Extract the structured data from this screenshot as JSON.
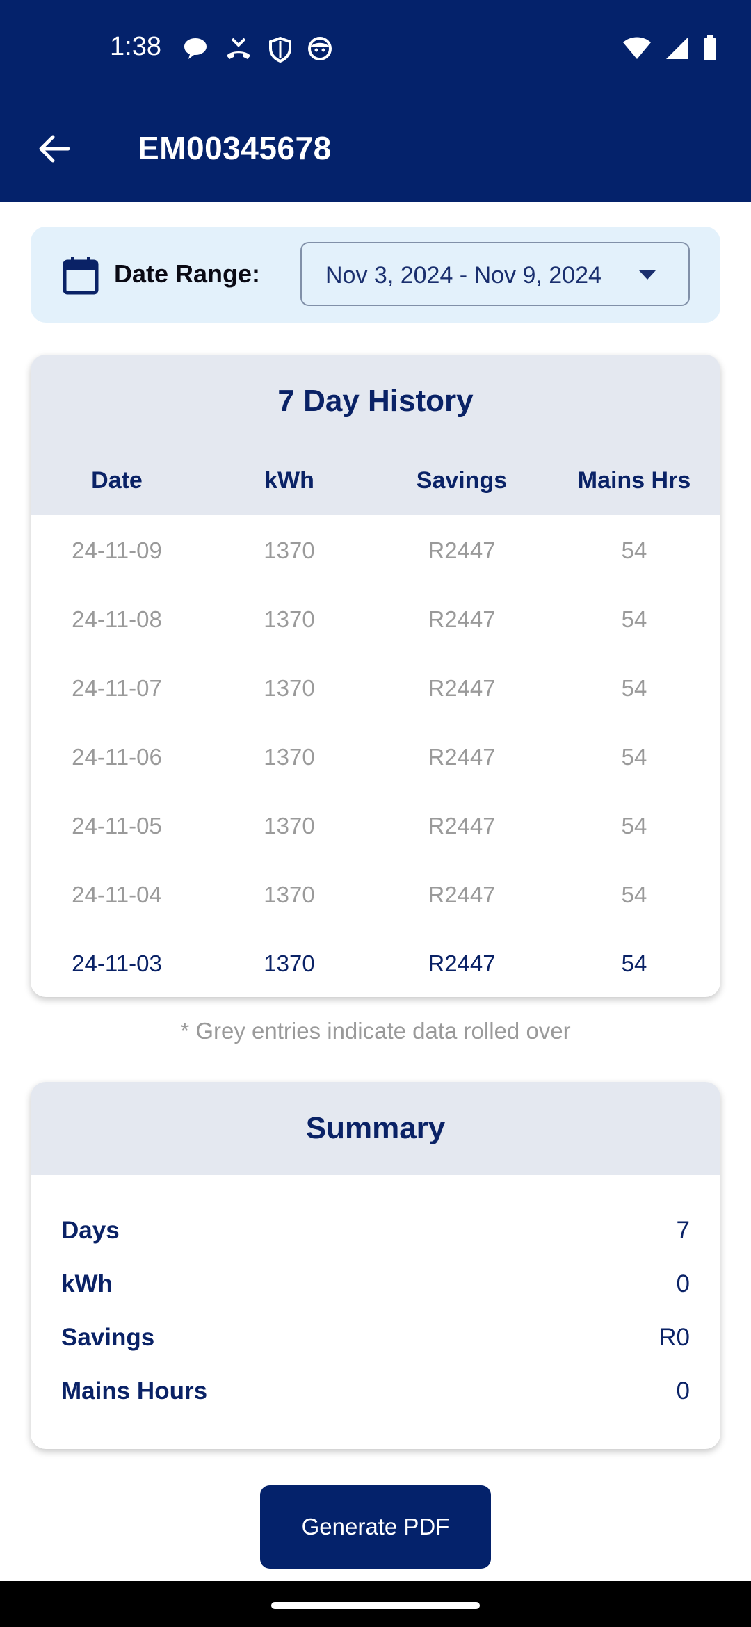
{
  "status_bar": {
    "time": "1:38",
    "left_icons": [
      "chat-bubble-icon",
      "missed-call-icon",
      "shield-icon",
      "face-icon"
    ],
    "right_icons": [
      "wifi-icon",
      "signal-icon",
      "battery-icon"
    ]
  },
  "toolbar": {
    "title": "EM00345678",
    "back_icon": "arrow-left-icon"
  },
  "date_range": {
    "label": "Date Range:",
    "selected": "Nov 3, 2024 - Nov 9, 2024"
  },
  "history": {
    "title": "7 Day History",
    "columns": [
      "Date",
      "kWh",
      "Savings",
      "Mains Hrs"
    ],
    "rows": [
      {
        "date": "24-11-09",
        "kwh": "1370",
        "savings": "R2447",
        "mains_hrs": "54",
        "rolled_over": true
      },
      {
        "date": "24-11-08",
        "kwh": "1370",
        "savings": "R2447",
        "mains_hrs": "54",
        "rolled_over": true
      },
      {
        "date": "24-11-07",
        "kwh": "1370",
        "savings": "R2447",
        "mains_hrs": "54",
        "rolled_over": true
      },
      {
        "date": "24-11-06",
        "kwh": "1370",
        "savings": "R2447",
        "mains_hrs": "54",
        "rolled_over": true
      },
      {
        "date": "24-11-05",
        "kwh": "1370",
        "savings": "R2447",
        "mains_hrs": "54",
        "rolled_over": true
      },
      {
        "date": "24-11-04",
        "kwh": "1370",
        "savings": "R2447",
        "mains_hrs": "54",
        "rolled_over": true
      },
      {
        "date": "24-11-03",
        "kwh": "1370",
        "savings": "R2447",
        "mains_hrs": "54",
        "rolled_over": false
      }
    ],
    "footnote": "* Grey entries indicate data rolled over"
  },
  "summary": {
    "title": "Summary",
    "items": [
      {
        "label": "Days",
        "value": "7"
      },
      {
        "label": "kWh",
        "value": "0"
      },
      {
        "label": "Savings",
        "value": "R0"
      },
      {
        "label": "Mains Hours",
        "value": "0"
      }
    ]
  },
  "actions": {
    "generate_pdf": "Generate PDF"
  },
  "colors": {
    "primary": "#04226b",
    "date_card_bg": "#e3f1fb",
    "card_header_bg": "#e4e8f0",
    "rolled_over_text": "#9a9a9a"
  }
}
